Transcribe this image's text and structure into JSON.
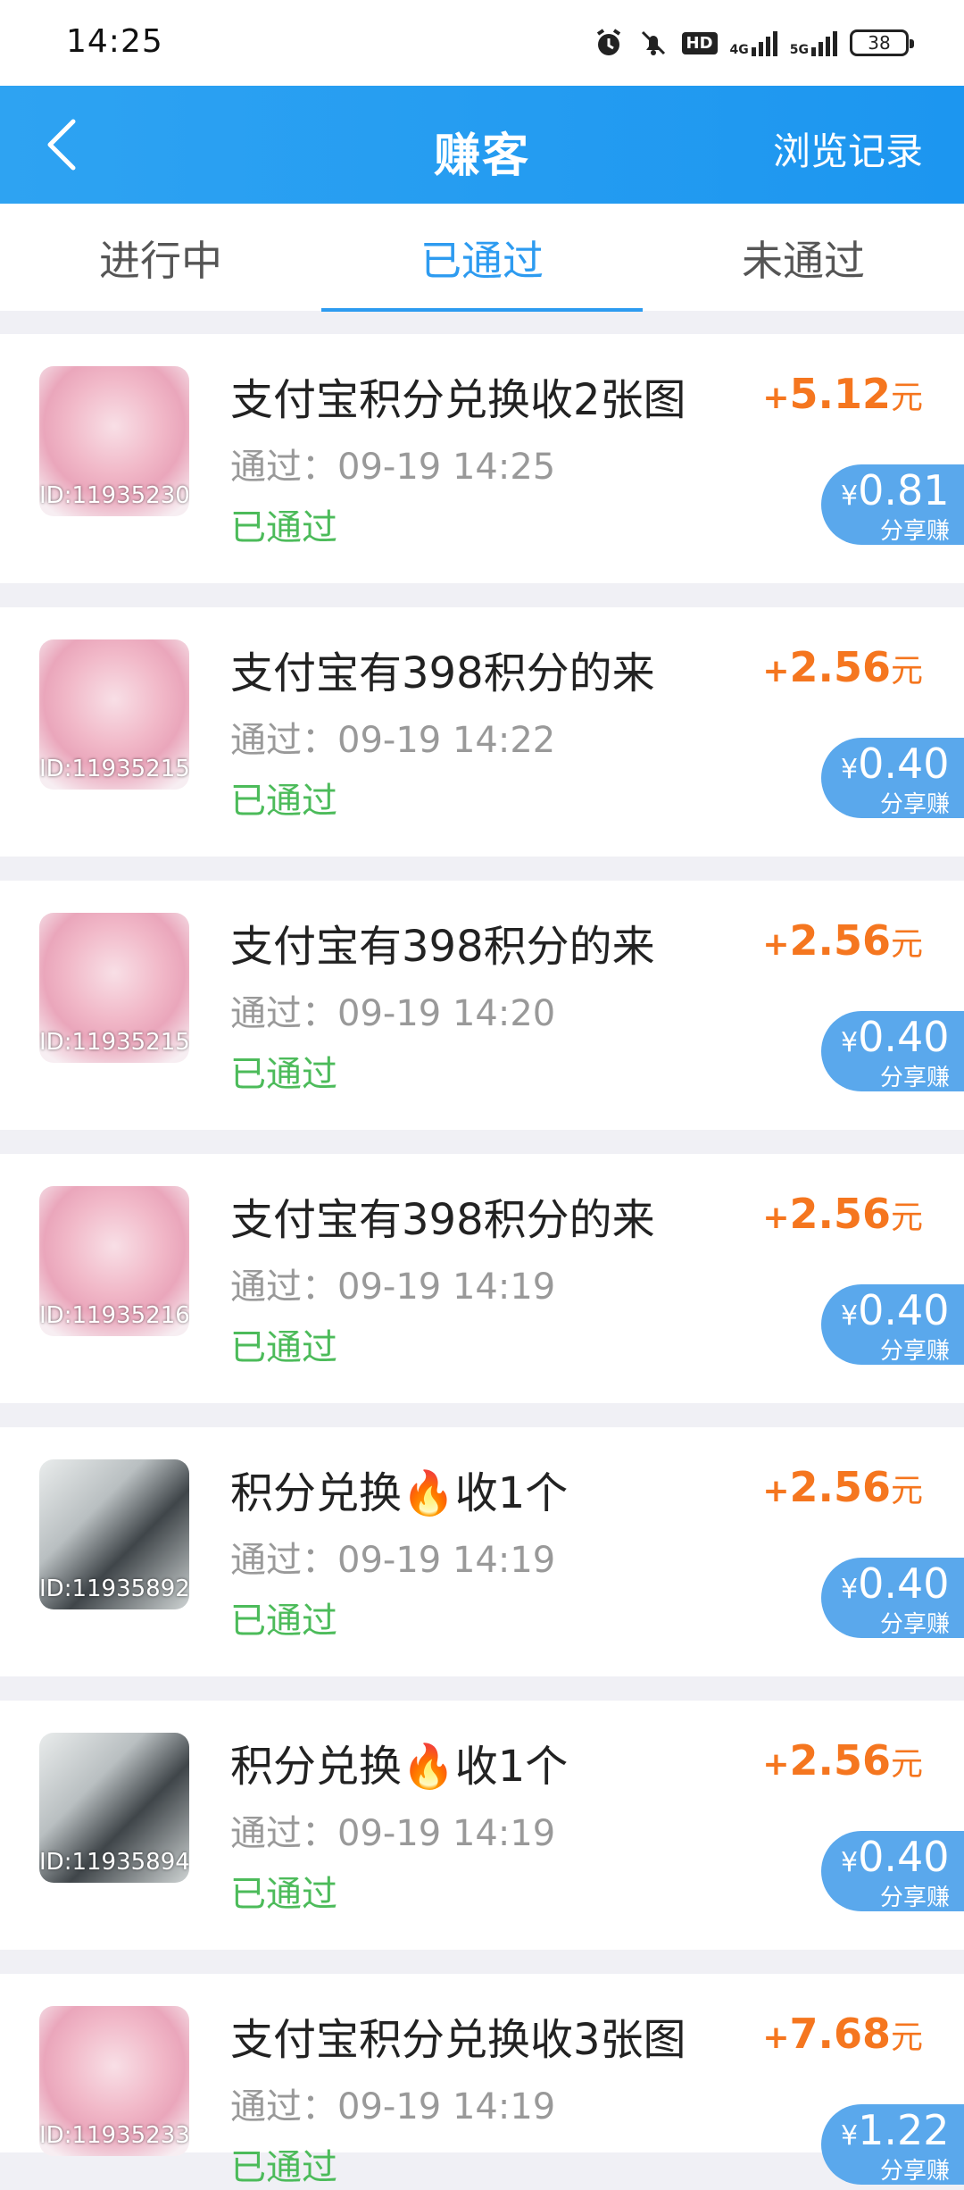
{
  "status_bar": {
    "time": "14:25",
    "hd": "HD",
    "net1": "4G",
    "net2": "5G",
    "battery": "38"
  },
  "app_bar": {
    "title": "赚客",
    "history": "浏览记录"
  },
  "tabs": [
    {
      "label": "进行中",
      "active": false
    },
    {
      "label": "已通过",
      "active": true
    },
    {
      "label": "未通过",
      "active": false
    }
  ],
  "items": [
    {
      "id_tag": "ID:11935230",
      "name": "支付宝积分兑换收2张图",
      "time": "通过：09-19 14:25",
      "status": "已通过",
      "reward_sign": "+",
      "reward": "5.12",
      "reward_unit": "元",
      "share_yen": "¥",
      "share_amount": "0.81",
      "share_label": "分享赚"
    },
    {
      "id_tag": "ID:11935215",
      "name": "支付宝有398积分的来",
      "time": "通过：09-19 14:22",
      "status": "已通过",
      "reward_sign": "+",
      "reward": "2.56",
      "reward_unit": "元",
      "share_yen": "¥",
      "share_amount": "0.40",
      "share_label": "分享赚"
    },
    {
      "id_tag": "ID:11935215",
      "name": "支付宝有398积分的来",
      "time": "通过：09-19 14:20",
      "status": "已通过",
      "reward_sign": "+",
      "reward": "2.56",
      "reward_unit": "元",
      "share_yen": "¥",
      "share_amount": "0.40",
      "share_label": "分享赚"
    },
    {
      "id_tag": "ID:11935216",
      "name": "支付宝有398积分的来",
      "time": "通过：09-19 14:19",
      "status": "已通过",
      "reward_sign": "+",
      "reward": "2.56",
      "reward_unit": "元",
      "share_yen": "¥",
      "share_amount": "0.40",
      "share_label": "分享赚"
    },
    {
      "id_tag": "ID:11935892",
      "name": "积分兑换🔥收1个",
      "time": "通过：09-19 14:19",
      "status": "已通过",
      "reward_sign": "+",
      "reward": "2.56",
      "reward_unit": "元",
      "share_yen": "¥",
      "share_amount": "0.40",
      "share_label": "分享赚"
    },
    {
      "id_tag": "ID:11935894",
      "name": "积分兑换🔥收1个",
      "time": "通过：09-19 14:19",
      "status": "已通过",
      "reward_sign": "+",
      "reward": "2.56",
      "reward_unit": "元",
      "share_yen": "¥",
      "share_amount": "0.40",
      "share_label": "分享赚"
    },
    {
      "id_tag": "ID:11935233",
      "name": "支付宝积分兑换收3张图",
      "time": "通过：09-19 14:19",
      "status": "已通过",
      "reward_sign": "+",
      "reward": "7.68",
      "reward_unit": "元",
      "share_yen": "¥",
      "share_amount": "1.22",
      "share_label": "分享赚"
    }
  ],
  "colors": {
    "primary": "#2d9bf0",
    "reward": "#f5761f",
    "passed": "#4cbb5a",
    "share": "#5aa8ec"
  }
}
